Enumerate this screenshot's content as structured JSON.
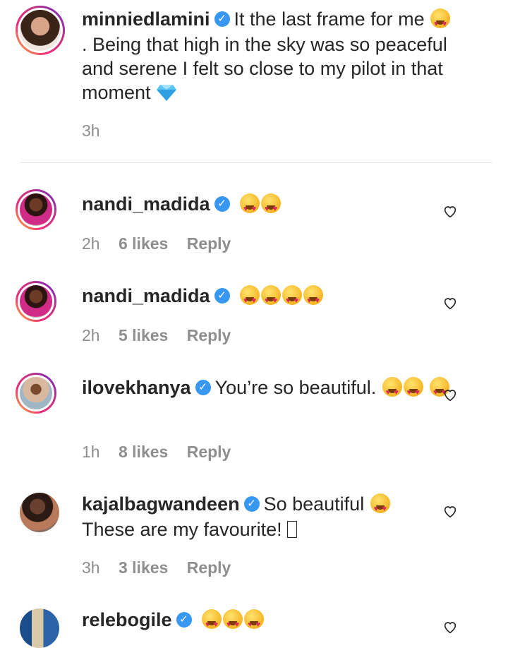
{
  "caption": {
    "username": "minniedlamini",
    "text_1": "It the last frame for me",
    "text_2": ". Being that high in the sky was so peaceful and serene I felt so close to my pilot in that moment",
    "time": "3h"
  },
  "comments": [
    {
      "username": "nandi_madida",
      "text": "",
      "emoji_count": 2,
      "time": "2h",
      "likes": "6 likes",
      "reply": "Reply"
    },
    {
      "username": "nandi_madida",
      "text": "",
      "emoji_count": 4,
      "time": "2h",
      "likes": "5 likes",
      "reply": "Reply"
    },
    {
      "username": "ilovekhanya",
      "text": "You’re so beautiful.",
      "emoji_count": 3,
      "time": "1h",
      "likes": "8 likes",
      "reply": "Reply"
    },
    {
      "username": "kajalbagwandeen",
      "text": "So beautiful",
      "text_2": "These are my favourite! ",
      "emoji_count": 1,
      "time": "3h",
      "likes": "3 likes",
      "reply": "Reply"
    },
    {
      "username": "relebogile",
      "text": "",
      "emoji_count": 3
    }
  ],
  "colors": {
    "verified": "#3897f0",
    "meta": "#8e8e8e",
    "text": "#262626"
  },
  "icons": {
    "verified": "verified-badge-icon",
    "like": "heart-outline-icon",
    "emoji": "heart-eyes-emoji",
    "diamond": "gem-emoji"
  }
}
